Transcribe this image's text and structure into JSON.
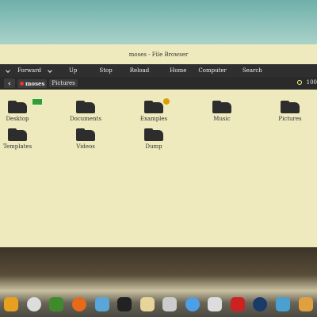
{
  "window": {
    "title": "moses - File Browser"
  },
  "toolbar": {
    "items": [
      "Forward",
      "Up",
      "Stop",
      "Reload",
      "Home",
      "Computer",
      "Search"
    ]
  },
  "location": {
    "crumbs": [
      "moses",
      "Pictures"
    ],
    "zoom_value": "100"
  },
  "files": [
    {
      "name": "Desktop",
      "emblem": "money"
    },
    {
      "name": "Documents",
      "emblem": ""
    },
    {
      "name": "Examples",
      "emblem": "info"
    },
    {
      "name": "Music",
      "emblem": ""
    },
    {
      "name": "Pictures",
      "emblem": ""
    },
    {
      "name": "Templates",
      "emblem": ""
    },
    {
      "name": "Videos",
      "emblem": ""
    },
    {
      "name": "Dump",
      "emblem": ""
    }
  ],
  "dock": {
    "icons": [
      {
        "name": "pinwheel-icon",
        "color": "#e8a020"
      },
      {
        "name": "clock-icon",
        "color": "#dddddd"
      },
      {
        "name": "tree-icon",
        "color": "#3f8a2d"
      },
      {
        "name": "firefox-icon",
        "color": "#e66a1a"
      },
      {
        "name": "chat-icon",
        "color": "#5aa6d8"
      },
      {
        "name": "terminal-icon",
        "color": "#222222"
      },
      {
        "name": "notes-icon",
        "color": "#e6d49a"
      },
      {
        "name": "headphones-icon",
        "color": "#cccccc"
      },
      {
        "name": "globe-icon",
        "color": "#4d9fe8"
      },
      {
        "name": "font-viewer-icon",
        "color": "#dddddd"
      },
      {
        "name": "red-app-icon",
        "color": "#cc2222"
      },
      {
        "name": "eye-icon",
        "color": "#1a3a6a"
      },
      {
        "name": "monitor-icon",
        "color": "#4aa0d0"
      },
      {
        "name": "home-icon",
        "color": "#e0a040"
      }
    ]
  }
}
